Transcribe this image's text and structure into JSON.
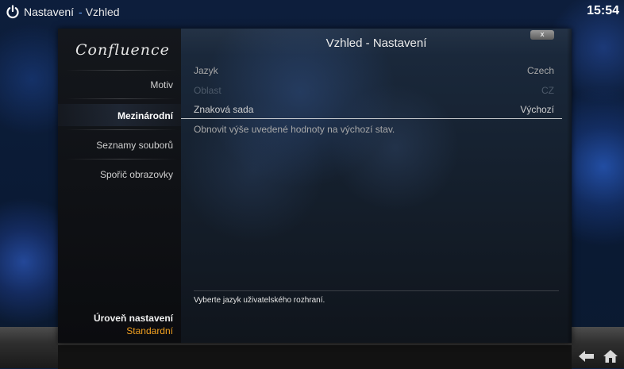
{
  "header": {
    "section": "Nastavení",
    "subsection": "Vzhled",
    "clock": "15:54"
  },
  "sidebar": {
    "logo": "Confluence",
    "items": [
      {
        "label": "Motiv",
        "active": false
      },
      {
        "label": "Mezinárodní",
        "active": true
      },
      {
        "label": "Seznamy souborů",
        "active": false
      },
      {
        "label": "Spořič obrazovky",
        "active": false
      }
    ],
    "settings_level": {
      "label": "Úroveň nastavení",
      "value": "Standardní"
    }
  },
  "dialog": {
    "title": "Vzhled - Nastavení",
    "close_label": "x",
    "settings": [
      {
        "label": "Jazyk",
        "value": "Czech",
        "state": "normal"
      },
      {
        "label": "Oblast",
        "value": "CZ",
        "state": "disabled"
      },
      {
        "label": "Znaková sada",
        "value": "Výchozí",
        "state": "focused"
      }
    ],
    "reset_label": "Obnovit výše uvedené hodnoty na výchozí stav.",
    "description": "Vyberte jazyk uživatelského rozhraní."
  },
  "colors": {
    "accent_orange": "#f0a020",
    "crumb_separator": "#6aa7ff",
    "disabled_text": "#4d5a6a"
  },
  "icons": {
    "power": "power-icon",
    "back": "back-arrow-icon",
    "home": "home-icon"
  }
}
